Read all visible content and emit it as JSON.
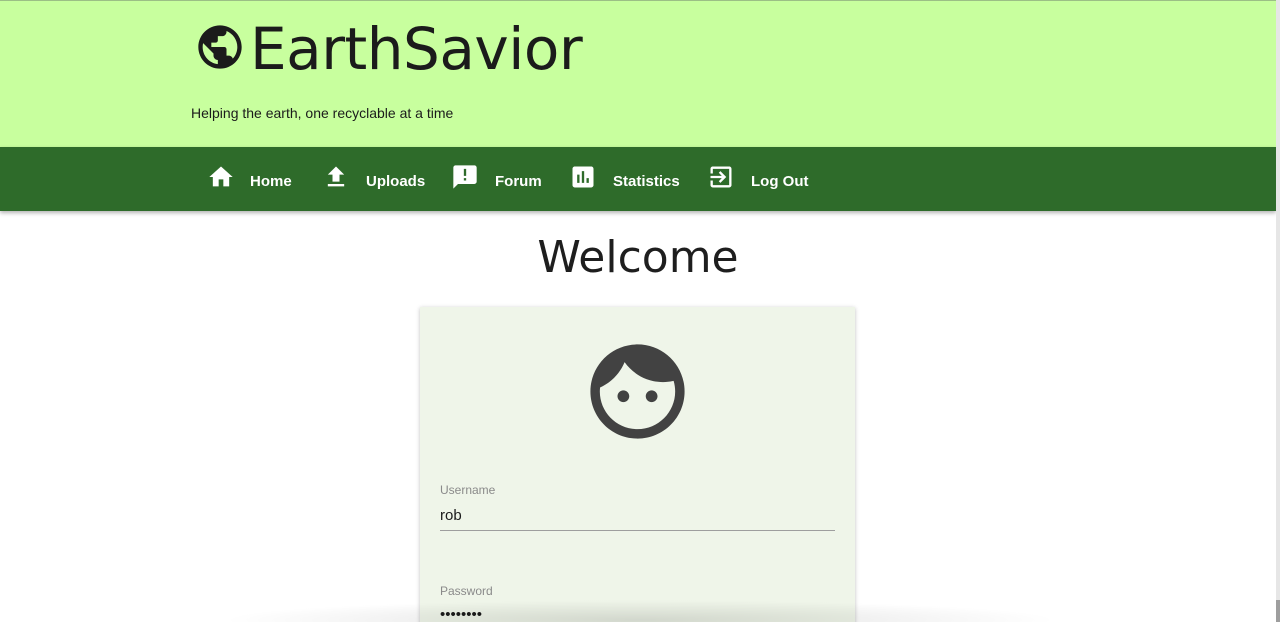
{
  "brand": {
    "title": "EarthSavior",
    "icon": "globe-icon",
    "tagline": "Helping the earth, one recyclable at a time"
  },
  "nav": {
    "items": [
      {
        "label": "Home",
        "icon": "home-icon"
      },
      {
        "label": "Uploads",
        "icon": "upload-icon"
      },
      {
        "label": "Forum",
        "icon": "forum-icon"
      },
      {
        "label": "Statistics",
        "icon": "statistics-icon"
      },
      {
        "label": "Log Out",
        "icon": "logout-icon"
      }
    ]
  },
  "main": {
    "title": "Welcome",
    "login": {
      "avatar_icon": "face-icon",
      "username": {
        "label": "Username",
        "value": "rob"
      },
      "password": {
        "label": "Password",
        "value": "••••••••"
      }
    }
  },
  "colors": {
    "header_bg": "#c8ff9e",
    "nav_bg": "#2e6b2a",
    "card_bg": "#eff5e9"
  }
}
